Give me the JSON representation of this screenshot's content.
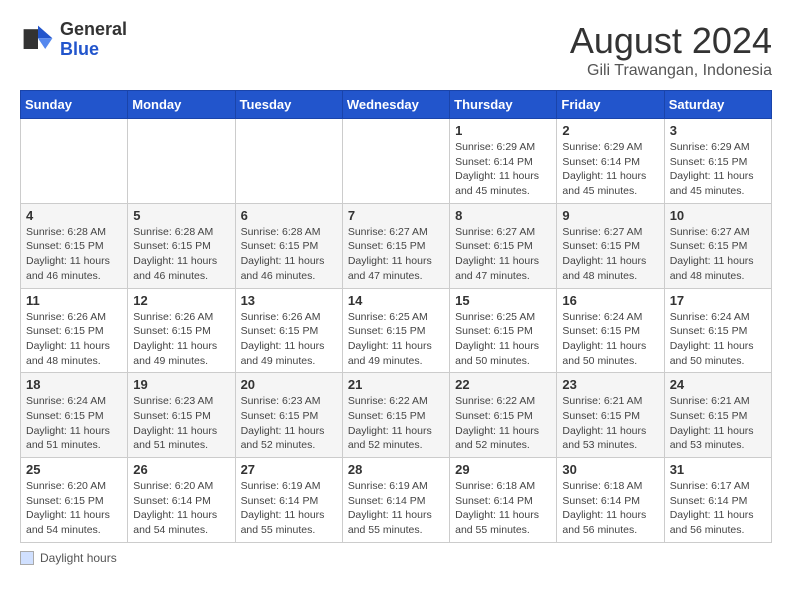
{
  "header": {
    "logo_general": "General",
    "logo_blue": "Blue",
    "month_year": "August 2024",
    "location": "Gili Trawangan, Indonesia"
  },
  "footer": {
    "label": "Daylight hours"
  },
  "days_of_week": [
    "Sunday",
    "Monday",
    "Tuesday",
    "Wednesday",
    "Thursday",
    "Friday",
    "Saturday"
  ],
  "weeks": [
    [
      {
        "day": "",
        "info": ""
      },
      {
        "day": "",
        "info": ""
      },
      {
        "day": "",
        "info": ""
      },
      {
        "day": "",
        "info": ""
      },
      {
        "day": "1",
        "info": "Sunrise: 6:29 AM\nSunset: 6:14 PM\nDaylight: 11 hours and 45 minutes."
      },
      {
        "day": "2",
        "info": "Sunrise: 6:29 AM\nSunset: 6:14 PM\nDaylight: 11 hours and 45 minutes."
      },
      {
        "day": "3",
        "info": "Sunrise: 6:29 AM\nSunset: 6:15 PM\nDaylight: 11 hours and 45 minutes."
      }
    ],
    [
      {
        "day": "4",
        "info": "Sunrise: 6:28 AM\nSunset: 6:15 PM\nDaylight: 11 hours and 46 minutes."
      },
      {
        "day": "5",
        "info": "Sunrise: 6:28 AM\nSunset: 6:15 PM\nDaylight: 11 hours and 46 minutes."
      },
      {
        "day": "6",
        "info": "Sunrise: 6:28 AM\nSunset: 6:15 PM\nDaylight: 11 hours and 46 minutes."
      },
      {
        "day": "7",
        "info": "Sunrise: 6:27 AM\nSunset: 6:15 PM\nDaylight: 11 hours and 47 minutes."
      },
      {
        "day": "8",
        "info": "Sunrise: 6:27 AM\nSunset: 6:15 PM\nDaylight: 11 hours and 47 minutes."
      },
      {
        "day": "9",
        "info": "Sunrise: 6:27 AM\nSunset: 6:15 PM\nDaylight: 11 hours and 48 minutes."
      },
      {
        "day": "10",
        "info": "Sunrise: 6:27 AM\nSunset: 6:15 PM\nDaylight: 11 hours and 48 minutes."
      }
    ],
    [
      {
        "day": "11",
        "info": "Sunrise: 6:26 AM\nSunset: 6:15 PM\nDaylight: 11 hours and 48 minutes."
      },
      {
        "day": "12",
        "info": "Sunrise: 6:26 AM\nSunset: 6:15 PM\nDaylight: 11 hours and 49 minutes."
      },
      {
        "day": "13",
        "info": "Sunrise: 6:26 AM\nSunset: 6:15 PM\nDaylight: 11 hours and 49 minutes."
      },
      {
        "day": "14",
        "info": "Sunrise: 6:25 AM\nSunset: 6:15 PM\nDaylight: 11 hours and 49 minutes."
      },
      {
        "day": "15",
        "info": "Sunrise: 6:25 AM\nSunset: 6:15 PM\nDaylight: 11 hours and 50 minutes."
      },
      {
        "day": "16",
        "info": "Sunrise: 6:24 AM\nSunset: 6:15 PM\nDaylight: 11 hours and 50 minutes."
      },
      {
        "day": "17",
        "info": "Sunrise: 6:24 AM\nSunset: 6:15 PM\nDaylight: 11 hours and 50 minutes."
      }
    ],
    [
      {
        "day": "18",
        "info": "Sunrise: 6:24 AM\nSunset: 6:15 PM\nDaylight: 11 hours and 51 minutes."
      },
      {
        "day": "19",
        "info": "Sunrise: 6:23 AM\nSunset: 6:15 PM\nDaylight: 11 hours and 51 minutes."
      },
      {
        "day": "20",
        "info": "Sunrise: 6:23 AM\nSunset: 6:15 PM\nDaylight: 11 hours and 52 minutes."
      },
      {
        "day": "21",
        "info": "Sunrise: 6:22 AM\nSunset: 6:15 PM\nDaylight: 11 hours and 52 minutes."
      },
      {
        "day": "22",
        "info": "Sunrise: 6:22 AM\nSunset: 6:15 PM\nDaylight: 11 hours and 52 minutes."
      },
      {
        "day": "23",
        "info": "Sunrise: 6:21 AM\nSunset: 6:15 PM\nDaylight: 11 hours and 53 minutes."
      },
      {
        "day": "24",
        "info": "Sunrise: 6:21 AM\nSunset: 6:15 PM\nDaylight: 11 hours and 53 minutes."
      }
    ],
    [
      {
        "day": "25",
        "info": "Sunrise: 6:20 AM\nSunset: 6:15 PM\nDaylight: 11 hours and 54 minutes."
      },
      {
        "day": "26",
        "info": "Sunrise: 6:20 AM\nSunset: 6:14 PM\nDaylight: 11 hours and 54 minutes."
      },
      {
        "day": "27",
        "info": "Sunrise: 6:19 AM\nSunset: 6:14 PM\nDaylight: 11 hours and 55 minutes."
      },
      {
        "day": "28",
        "info": "Sunrise: 6:19 AM\nSunset: 6:14 PM\nDaylight: 11 hours and 55 minutes."
      },
      {
        "day": "29",
        "info": "Sunrise: 6:18 AM\nSunset: 6:14 PM\nDaylight: 11 hours and 55 minutes."
      },
      {
        "day": "30",
        "info": "Sunrise: 6:18 AM\nSunset: 6:14 PM\nDaylight: 11 hours and 56 minutes."
      },
      {
        "day": "31",
        "info": "Sunrise: 6:17 AM\nSunset: 6:14 PM\nDaylight: 11 hours and 56 minutes."
      }
    ]
  ]
}
